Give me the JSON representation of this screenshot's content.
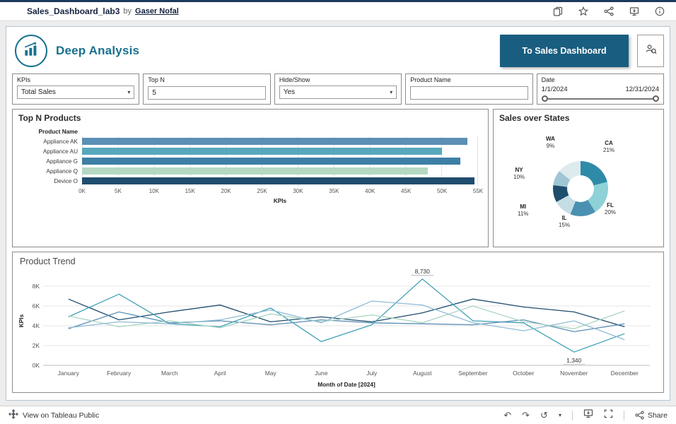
{
  "topbar": {
    "title": "Sales_Dashboard_lab3",
    "by_text": "by",
    "author": "Gaser Nofal"
  },
  "dashboard_header": {
    "title": "Deep Analysis",
    "nav_button": "To Sales Dashboard"
  },
  "filters": {
    "kpis": {
      "label": "KPIs",
      "value": "Total Sales"
    },
    "top_n": {
      "label": "Top N",
      "value": "5"
    },
    "hide_show": {
      "label": "Hide/Show",
      "value": "Yes"
    },
    "product_name": {
      "label": "Product Name",
      "value": ""
    },
    "date": {
      "label": "Date",
      "start": "1/1/2024",
      "end": "12/31/2024"
    }
  },
  "panels": {
    "top_n_title": "Top N Products",
    "states_title": "Sales over States",
    "trend_title": "Product Trend"
  },
  "footer": {
    "view_text": "View on Tableau Public",
    "share_label": "Share"
  },
  "chart_data": [
    {
      "type": "bar",
      "name": "top_n_products",
      "title": "Top N Products",
      "orientation": "horizontal",
      "ylabel": "Product Name",
      "xlabel": "KPIs",
      "categories": [
        "Appliance AK",
        "Appliance AU",
        "Appliance G",
        "Appliance Q",
        "Device O"
      ],
      "values": [
        53500,
        50000,
        52500,
        48000,
        54500
      ],
      "colors": [
        "#5b8fb5",
        "#57a8bc",
        "#3e7fa6",
        "#b5d8c2",
        "#1f4d6e"
      ],
      "x_ticks": [
        "0K",
        "5K",
        "10K",
        "15K",
        "20K",
        "25K",
        "30K",
        "35K",
        "40K",
        "45K",
        "50K",
        "55K"
      ],
      "xlim": [
        0,
        55000
      ]
    },
    {
      "type": "pie",
      "name": "sales_over_states",
      "title": "Sales over States",
      "donut": true,
      "slices": [
        {
          "abbr": "CA",
          "pct": 21,
          "color": "#2e8ba8"
        },
        {
          "abbr": "FL",
          "pct": 20,
          "color": "#8ed1d6"
        },
        {
          "abbr": "IL",
          "pct": 15,
          "color": "#4a90b0"
        },
        {
          "abbr": "MI",
          "pct": 11,
          "color": "#c5dde4"
        },
        {
          "abbr": "NY",
          "pct": 10,
          "color": "#1f4d6e"
        },
        {
          "abbr": "WA",
          "pct": 9,
          "color": "#9fc6d4"
        }
      ],
      "unlabeled_pct": 14,
      "unlabeled_color": "#ddeaee"
    },
    {
      "type": "line",
      "name": "product_trend",
      "title": "Product Trend",
      "x": [
        "January",
        "February",
        "March",
        "April",
        "May",
        "June",
        "July",
        "August",
        "September",
        "October",
        "November",
        "December"
      ],
      "series": [
        {
          "name": "Device O",
          "color": "#1f4d6e",
          "values": [
            6.7,
            4.6,
            5.4,
            6.1,
            4.4,
            4.9,
            4.4,
            5.3,
            6.7,
            5.9,
            5.4,
            3.9
          ]
        },
        {
          "name": "Appliance AU",
          "color": "#3fa0b5",
          "values": [
            4.9,
            7.2,
            4.2,
            3.9,
            5.8,
            2.4,
            4.1,
            8.73,
            4.5,
            4.3,
            1.34,
            3.2
          ]
        },
        {
          "name": "Appliance AK",
          "color": "#5b8fb5",
          "values": [
            3.7,
            5.4,
            4.3,
            4.5,
            4.1,
            4.6,
            4.3,
            4.2,
            4.1,
            4.6,
            3.4,
            4.2
          ]
        },
        {
          "name": "Appliance Q",
          "color": "#a9d4c3",
          "values": [
            5.0,
            3.9,
            4.5,
            3.8,
            5.2,
            4.4,
            5.1,
            4.3,
            6.0,
            4.4,
            3.7,
            5.5
          ]
        },
        {
          "name": "Appliance G",
          "color": "#8fbcd4",
          "values": [
            3.8,
            4.4,
            4.2,
            4.6,
            5.6,
            4.3,
            6.5,
            6.1,
            4.3,
            3.5,
            4.5,
            2.6
          ]
        }
      ],
      "y_ticks": [
        "0K",
        "2K",
        "4K",
        "6K",
        "8K"
      ],
      "ylim": [
        0,
        9
      ],
      "xlabel": "Month of Date [2024]",
      "ylabel": "KPIs",
      "annotations": [
        {
          "text": "8,730",
          "x_index": 7,
          "value": 8.73,
          "position": "above"
        },
        {
          "text": "1,340",
          "x_index": 10,
          "value": 1.34,
          "position": "below"
        }
      ]
    }
  ]
}
